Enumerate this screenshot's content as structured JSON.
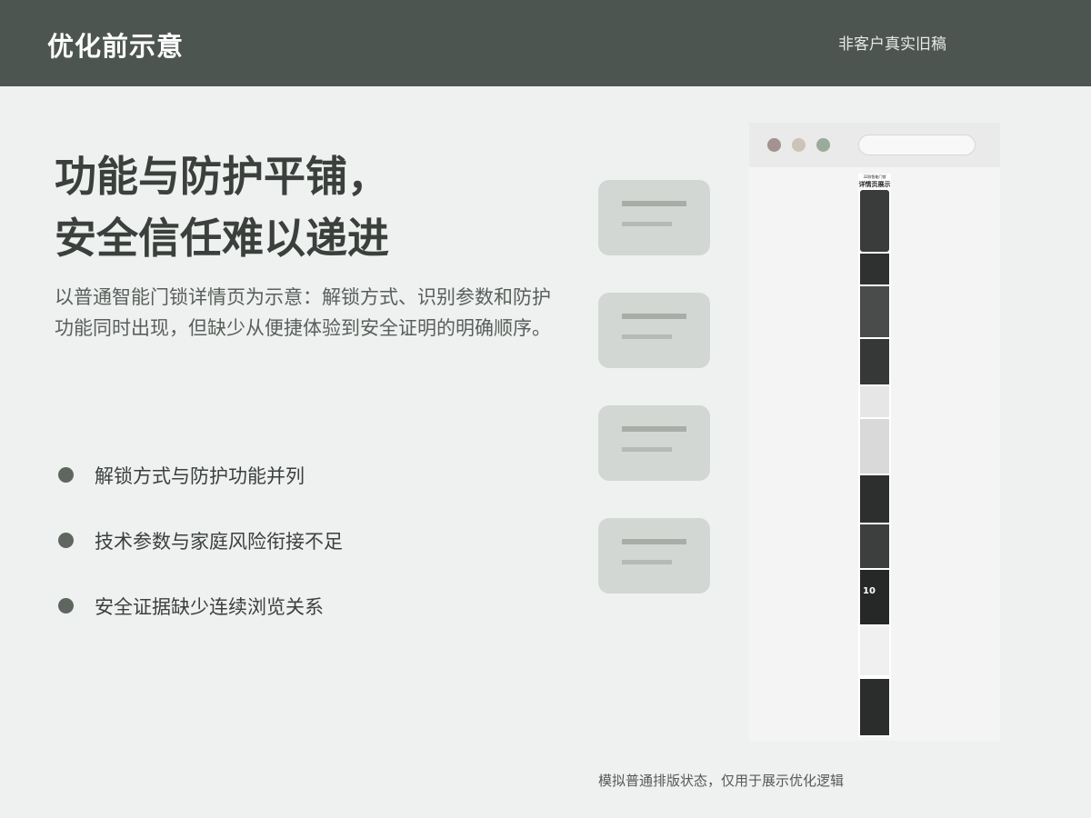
{
  "header": {
    "title": "优化前示意",
    "note": "非客户真实旧稿"
  },
  "main": {
    "headline_line1": "功能与防护平铺，",
    "headline_line2": "安全信任难以递进",
    "description": "以普通智能门锁详情页为示意：解锁方式、识别参数和防护功能同时出现，但缺少从便捷体验到安全证明的明确顺序。",
    "bullets": [
      "解锁方式与防护功能并列",
      "技术参数与家庭风险衔接不足",
      "安全证据缺少连续浏览关系"
    ]
  },
  "mockup": {
    "window_dot_colors": [
      "#a3928f",
      "#cdc3b7",
      "#9aab9c"
    ],
    "strip_title_small": "32款智能门锁",
    "strip_title": "详情页展示",
    "strip_number": "10"
  },
  "footer": {
    "note": "模拟普通排版状态，仅用于展示优化逻辑"
  },
  "colors": {
    "header_bg": "#4d5550",
    "page_bg": "#eff1f0",
    "card_bg": "#d3d7d3",
    "bullet_dot": "#5f665f"
  }
}
